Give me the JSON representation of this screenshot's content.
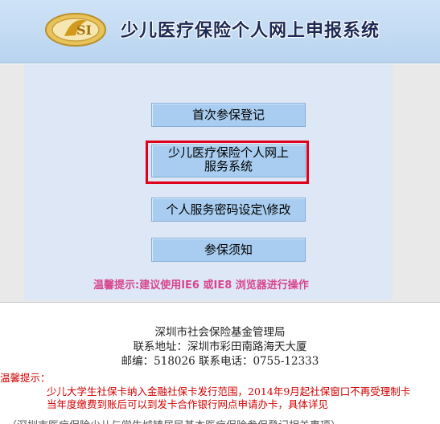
{
  "header": {
    "title": "少儿医疗保险个人网上申报系统",
    "logo_text": "SI"
  },
  "menu": {
    "first_enroll": "首次参保登记",
    "online_service_line1": "少儿医疗保险个人网上",
    "online_service_line2": "服务系统",
    "password_setup": "个人服务密码设定\\修改",
    "notice": "参保须知",
    "browser_hint": "温馨提示:建议使用IE6 或IE8 浏览器进行操作"
  },
  "footer": {
    "org": "深圳市社会保险基金管理局",
    "address": "联系地址：深圳市彩田南路海天大厦",
    "contact": "邮编：518026 联系电话：0755-12333",
    "notice_label": "温馨提示：",
    "notice_line1": "少儿大学生社保卡纳入金融社保卡发行范围，2014年9月起社保窗口不再受理制卡",
    "notice_line2": "当年度缴费到账后可以到发卡合作银行网点申请办卡，具体详见"
  },
  "colors": {
    "header_bg": "#c6dcf3",
    "button_bg": "#a8cdf0",
    "highlight": "#e0001b",
    "hint_text": "#d9458f",
    "notice_text": "#d00000"
  }
}
